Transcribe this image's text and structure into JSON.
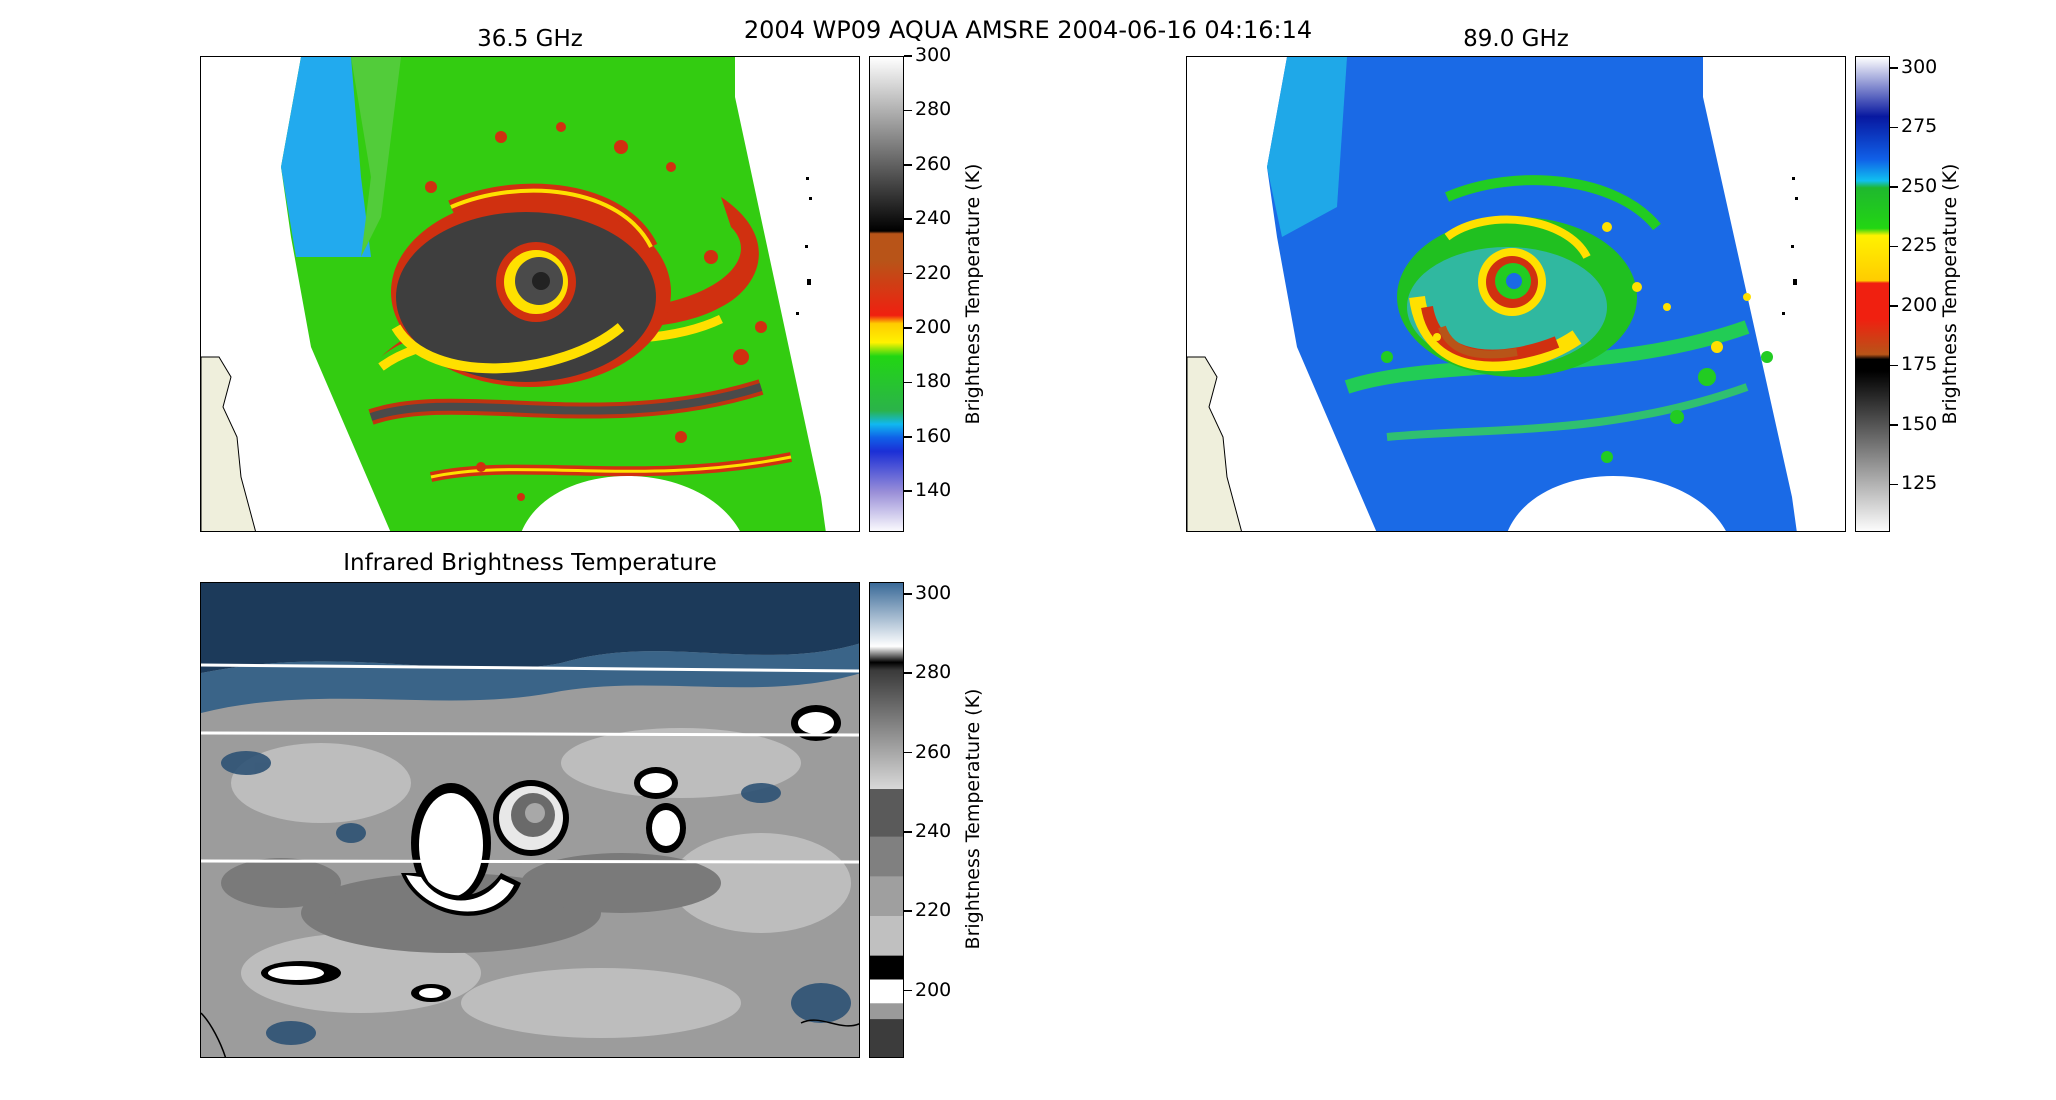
{
  "figure": {
    "suptitle": "2004 WP09 AQUA AMSRE 2004-06-16 04:16:14"
  },
  "chart_data": [
    {
      "type": "heatmap",
      "title": "36.5 GHz",
      "colorbar": {
        "label": "Brightness Temperature (K)",
        "range": [
          125,
          300
        ],
        "ticks": [
          300,
          280,
          260,
          240,
          220,
          200,
          180,
          160,
          140
        ],
        "stops": [
          {
            "v": 125,
            "c": "#ffffff"
          },
          {
            "v": 140,
            "c": "#9a8fd8"
          },
          {
            "v": 155,
            "c": "#1b2fd6"
          },
          {
            "v": 160,
            "c": "#1060e8"
          },
          {
            "v": 165,
            "c": "#10b8f0"
          },
          {
            "v": 170,
            "c": "#2bb34a"
          },
          {
            "v": 190,
            "c": "#22d613"
          },
          {
            "v": 195,
            "c": "#fff200"
          },
          {
            "v": 202,
            "c": "#ffcc00"
          },
          {
            "v": 205,
            "c": "#f02010"
          },
          {
            "v": 225,
            "c": "#b85418"
          },
          {
            "v": 235,
            "c": "#b85418"
          },
          {
            "v": 236,
            "c": "#000000"
          },
          {
            "v": 300,
            "c": "#ffffff"
          }
        ]
      }
    },
    {
      "type": "heatmap",
      "title": "89.0 GHz",
      "colorbar": {
        "label": "Brightness Temperature (K)",
        "range": [
          105,
          305
        ],
        "ticks": [
          300,
          275,
          250,
          225,
          200,
          175,
          150,
          125
        ],
        "stops": [
          {
            "v": 105,
            "c": "#ffffff"
          },
          {
            "v": 173,
            "c": "#000000"
          },
          {
            "v": 178,
            "c": "#000000"
          },
          {
            "v": 180,
            "c": "#b85418"
          },
          {
            "v": 195,
            "c": "#f02010"
          },
          {
            "v": 210,
            "c": "#f02010"
          },
          {
            "v": 211,
            "c": "#ffcc00"
          },
          {
            "v": 230,
            "c": "#fff200"
          },
          {
            "v": 233,
            "c": "#22d613"
          },
          {
            "v": 250,
            "c": "#1fb82e"
          },
          {
            "v": 253,
            "c": "#10c0f0"
          },
          {
            "v": 262,
            "c": "#1060e8"
          },
          {
            "v": 280,
            "c": "#0818a0"
          },
          {
            "v": 305,
            "c": "#ffffff"
          }
        ]
      }
    },
    {
      "type": "heatmap",
      "title": "Infrared Brightness Temperature",
      "colorbar": {
        "label": "Brightness Temperature (K)",
        "range": [
          183,
          303
        ],
        "ticks": [
          300,
          280,
          260,
          240,
          220,
          200
        ],
        "stops": [
          {
            "v": 183,
            "c": "#3c3c3c"
          },
          {
            "v": 193,
            "c": "#3c3c3c"
          },
          {
            "v": 193.1,
            "c": "#9a9a9a"
          },
          {
            "v": 197,
            "c": "#9a9a9a"
          },
          {
            "v": 197.1,
            "c": "#ffffff"
          },
          {
            "v": 203,
            "c": "#ffffff"
          },
          {
            "v": 203.1,
            "c": "#000000"
          },
          {
            "v": 209,
            "c": "#000000"
          },
          {
            "v": 209.1,
            "c": "#c0c0c0"
          },
          {
            "v": 219,
            "c": "#c0c0c0"
          },
          {
            "v": 219.1,
            "c": "#9f9f9f"
          },
          {
            "v": 229,
            "c": "#9f9f9f"
          },
          {
            "v": 229.1,
            "c": "#808080"
          },
          {
            "v": 239,
            "c": "#808080"
          },
          {
            "v": 239.1,
            "c": "#5a5a5a"
          },
          {
            "v": 251,
            "c": "#5a5a5a"
          },
          {
            "v": 251.1,
            "c": "#d8d8d8"
          },
          {
            "v": 281,
            "c": "#3a3a3a"
          },
          {
            "v": 283,
            "c": "#000000"
          },
          {
            "v": 287,
            "c": "#ffffff"
          },
          {
            "v": 303,
            "c": "#3a6a98"
          }
        ]
      }
    }
  ]
}
